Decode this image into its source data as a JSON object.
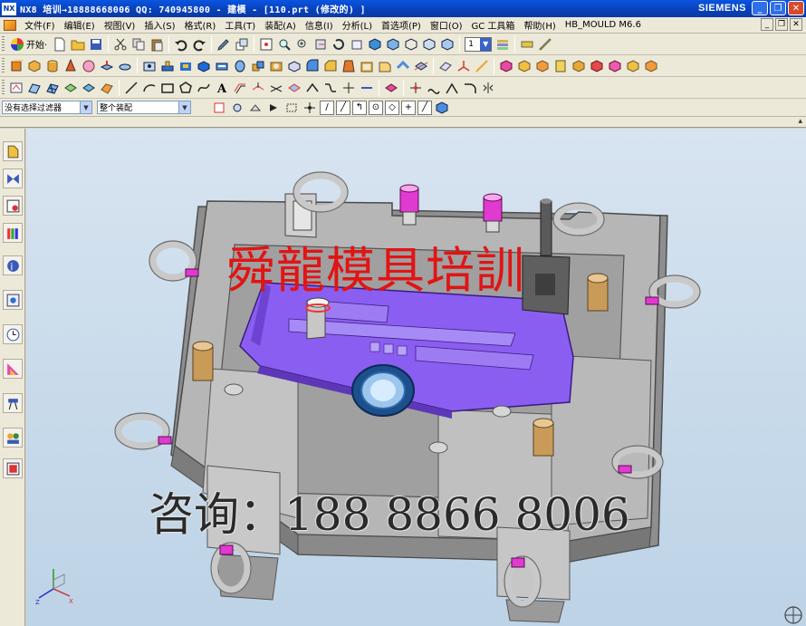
{
  "window": {
    "title": "NX8 培训→18888668006 QQ: 740945800 - 建模 - [110.prt (修改的) ]",
    "logo_text": "NX",
    "brand": "SIEMENS"
  },
  "menu": {
    "items": [
      "文件(F)",
      "编辑(E)",
      "视图(V)",
      "插入(S)",
      "格式(R)",
      "工具(T)",
      "装配(A)",
      "信息(I)",
      "分析(L)",
      "首选项(P)",
      "窗口(O)",
      "GC 工具箱",
      "帮助(H)",
      "HB_MOULD M6.6"
    ]
  },
  "toolbar": {
    "start_label": "开始·",
    "layer_value": "1"
  },
  "selection_bar": {
    "filter_value": "没有选择过滤器",
    "scope_value": "整个装配"
  },
  "viewport": {
    "watermark_title": "舜龍模具培訓",
    "watermark_contact": "咨询：188 8866 8006"
  },
  "colors": {
    "accent_purple": "#8a5ef0",
    "mould_gray": "#a8a8a8",
    "watermark_red": "#e11414"
  }
}
